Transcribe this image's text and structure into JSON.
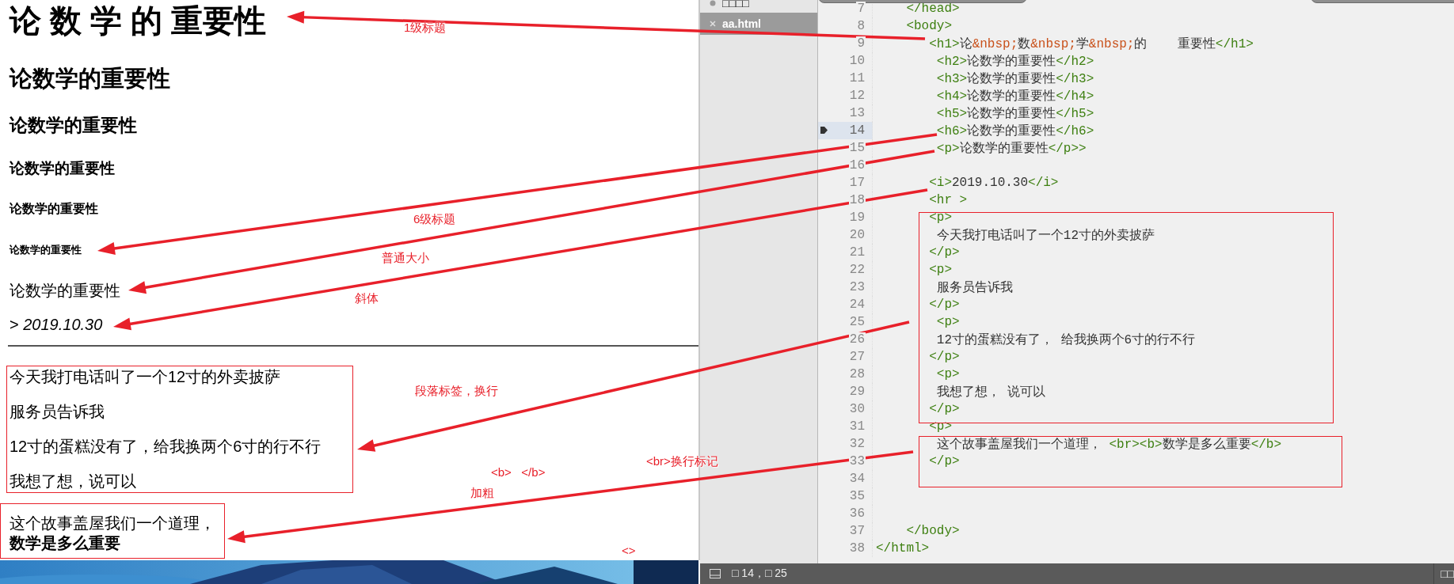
{
  "browser": {
    "blocks": [
      {
        "kind": "h1",
        "text": "论 数 学 的 重要性"
      },
      {
        "kind": "h2",
        "text": "论数学的重要性"
      },
      {
        "kind": "h3",
        "text": "论数学的重要性"
      },
      {
        "kind": "h4",
        "text": "论数学的重要性"
      },
      {
        "kind": "h5",
        "text": "论数学的重要性"
      },
      {
        "kind": "h6",
        "text": "论数学的重要性"
      },
      {
        "kind": "p",
        "text": "论数学的重要性"
      },
      {
        "kind": "p",
        "text": "> *2019.10.30*"
      },
      {
        "kind": "rule"
      },
      {
        "kind": "framed",
        "paragraphs": [
          "今天我打电话叫了一个12寸的外卖披萨",
          "服务员告诉我",
          "12寸的蛋糕没有了，给我换两个6寸的行不行",
          "我想了想，说可以"
        ]
      },
      {
        "kind": "framed-lines",
        "lines": [
          "这个故事盖屋我们一个道理，",
          "**数学是多么重要**"
        ]
      }
    ]
  },
  "annotations": {
    "labels": [
      "1级标题",
      "6级标题",
      "普通大小",
      "斜体",
      "段落标签，换行",
      "<b>   </b>",
      "加粗",
      "<br>换行标记",
      "<>"
    ]
  },
  "sidebar": {
    "items": [
      {
        "label": "□□□□",
        "selected": false
      },
      {
        "label": "aa.html",
        "selected": true
      }
    ]
  },
  "editor": {
    "lines": [
      {
        "number": "7",
        "bookmarked": false,
        "tokens": [
          {
            "kind": "tag",
            "text": "    </head>"
          }
        ]
      },
      {
        "number": "8",
        "bookmarked": false,
        "tokens": [
          {
            "kind": "tag",
            "text": "    <body>"
          }
        ]
      },
      {
        "number": "9",
        "bookmarked": false,
        "tokens": [
          {
            "kind": "tag",
            "text": "       <h1>"
          },
          {
            "kind": "text",
            "text": "论"
          },
          {
            "kind": "entity",
            "text": "&nbsp;"
          },
          {
            "kind": "text",
            "text": "数"
          },
          {
            "kind": "entity",
            "text": "&nbsp;"
          },
          {
            "kind": "text",
            "text": "学"
          },
          {
            "kind": "entity",
            "text": "&nbsp;"
          },
          {
            "kind": "text",
            "text": "的    重要性"
          },
          {
            "kind": "tag",
            "text": "</h1>"
          }
        ]
      },
      {
        "number": "10",
        "bookmarked": false,
        "tokens": [
          {
            "kind": "tag",
            "text": "        <h2>"
          },
          {
            "kind": "text",
            "text": "论数学的重要性"
          },
          {
            "kind": "tag",
            "text": "</h2>"
          }
        ]
      },
      {
        "number": "11",
        "bookmarked": false,
        "tokens": [
          {
            "kind": "tag",
            "text": "        <h3>"
          },
          {
            "kind": "text",
            "text": "论数学的重要性"
          },
          {
            "kind": "tag",
            "text": "</h3>"
          }
        ]
      },
      {
        "number": "12",
        "bookmarked": false,
        "tokens": [
          {
            "kind": "tag",
            "text": "        <h4>"
          },
          {
            "kind": "text",
            "text": "论数学的重要性"
          },
          {
            "kind": "tag",
            "text": "</h4>"
          }
        ]
      },
      {
        "number": "13",
        "bookmarked": false,
        "tokens": [
          {
            "kind": "tag",
            "text": "        <h5>"
          },
          {
            "kind": "text",
            "text": "论数学的重要性"
          },
          {
            "kind": "tag",
            "text": "</h5>"
          }
        ]
      },
      {
        "number": "14",
        "bookmarked": true,
        "tokens": [
          {
            "kind": "tag",
            "text": "        <h6>"
          },
          {
            "kind": "text",
            "text": "论数学的重要性"
          },
          {
            "kind": "tag",
            "text": "</h6>"
          }
        ]
      },
      {
        "number": "15",
        "bookmarked": false,
        "tokens": [
          {
            "kind": "tag",
            "text": "        <p>"
          },
          {
            "kind": "text",
            "text": "论数学的重要性"
          },
          {
            "kind": "tag",
            "text": "</p>>"
          }
        ]
      },
      {
        "number": "16",
        "bookmarked": false
      },
      {
        "number": "17",
        "bookmarked": false,
        "tokens": [
          {
            "kind": "tag",
            "text": "       <i>"
          },
          {
            "kind": "text",
            "text": "2019.10.30"
          },
          {
            "kind": "tag",
            "text": "</i>"
          }
        ]
      },
      {
        "number": "18",
        "bookmarked": false,
        "tokens": [
          {
            "kind": "tag",
            "text": "       <hr >"
          }
        ]
      },
      {
        "number": "19",
        "bookmarked": false,
        "tokens": [
          {
            "kind": "tag",
            "text": "       <p>"
          }
        ]
      },
      {
        "number": "20",
        "bookmarked": false,
        "tokens": [
          {
            "kind": "text",
            "text": "        今天我打电话叫了一个12寸的外卖披萨"
          }
        ]
      },
      {
        "number": "21",
        "bookmarked": false,
        "tokens": [
          {
            "kind": "tag",
            "text": "       </p>"
          }
        ]
      },
      {
        "number": "22",
        "bookmarked": false,
        "tokens": [
          {
            "kind": "tag",
            "text": "       <p>"
          }
        ]
      },
      {
        "number": "23",
        "bookmarked": false,
        "tokens": [
          {
            "kind": "text",
            "text": "        服务员告诉我"
          }
        ]
      },
      {
        "number": "24",
        "bookmarked": false,
        "tokens": [
          {
            "kind": "tag",
            "text": "       </p>"
          }
        ]
      },
      {
        "number": "25",
        "bookmarked": false,
        "tokens": [
          {
            "kind": "tag",
            "text": "        <p>"
          }
        ]
      },
      {
        "number": "26",
        "bookmarked": false,
        "tokens": [
          {
            "kind": "text",
            "text": "        12寸的蛋糕没有了， 给我换两个6寸的行不行"
          }
        ]
      },
      {
        "number": "27",
        "bookmarked": false,
        "tokens": [
          {
            "kind": "tag",
            "text": "       </p>"
          }
        ]
      },
      {
        "number": "28",
        "bookmarked": false,
        "tokens": [
          {
            "kind": "tag",
            "text": "        <p>"
          }
        ]
      },
      {
        "number": "29",
        "bookmarked": false,
        "tokens": [
          {
            "kind": "text",
            "text": "        我想了想， 说可以"
          }
        ]
      },
      {
        "number": "30",
        "bookmarked": false,
        "tokens": [
          {
            "kind": "tag",
            "text": "       </p>"
          }
        ]
      },
      {
        "number": "31",
        "bookmarked": false,
        "tokens": [
          {
            "kind": "tag",
            "text": "       <p>"
          }
        ]
      },
      {
        "number": "32",
        "bookmarked": false,
        "tokens": [
          {
            "kind": "text",
            "text": "        这个故事盖屋我们一个道理， "
          },
          {
            "kind": "tag",
            "text": "<br><b>"
          },
          {
            "kind": "text",
            "text": "数学是多么重要"
          },
          {
            "kind": "tag",
            "text": "</b>"
          }
        ]
      },
      {
        "number": "33",
        "bookmarked": false,
        "tokens": [
          {
            "kind": "tag",
            "text": "       </p>"
          }
        ]
      },
      {
        "number": "34",
        "bookmarked": false
      },
      {
        "number": "35",
        "bookmarked": false
      },
      {
        "number": "36",
        "bookmarked": false
      },
      {
        "number": "37",
        "bookmarked": false,
        "tokens": [
          {
            "kind": "tag",
            "text": "    </body>"
          }
        ]
      },
      {
        "number": "38",
        "bookmarked": false,
        "tokens": [
          {
            "kind": "tag",
            "text": "</html>"
          }
        ]
      }
    ]
  },
  "status_bar": {
    "position": "□ 14，□ 25",
    "right_text": "□□"
  }
}
